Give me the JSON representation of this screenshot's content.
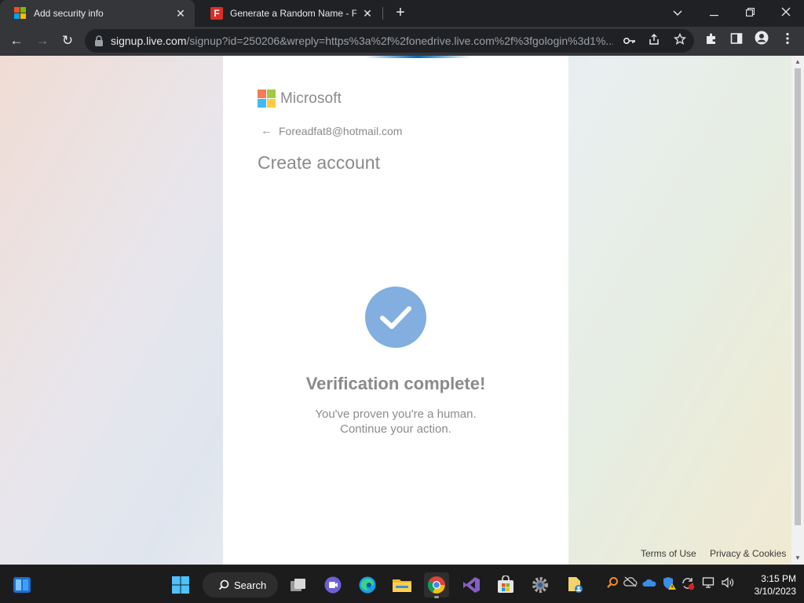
{
  "browser": {
    "tabs": [
      {
        "title": "Add security info",
        "active": true,
        "favicon": "microsoft-logo-icon"
      },
      {
        "title": "Generate a Random Name - Fake",
        "active": false,
        "favicon": "fake-name-generator-icon",
        "favicon_letter": "F"
      }
    ],
    "new_tab_glyph": "+",
    "window_controls": {
      "dropdown": "⌄",
      "minimize": "—",
      "restore": "❐",
      "close": "✕"
    },
    "url_host": "signup.live.com",
    "url_rest": "/signup?id=250206&wreply=https%3a%2f%2fonedrive.live.com%2f%3fgologin%3d1%...",
    "nav": {
      "back": "←",
      "forward": "→",
      "reload": "↻"
    }
  },
  "page": {
    "brand": "Microsoft",
    "identity_email": "Foreadfat8@hotmail.com",
    "back_arrow": "←",
    "title": "Create account",
    "verification_title": "Verification complete!",
    "verification_line1": "You've proven you're a human.",
    "verification_line2": "Continue your action.",
    "footer": {
      "terms": "Terms of Use",
      "privacy": "Privacy & Cookies"
    }
  },
  "taskbar": {
    "search_label": "Search",
    "time": "3:15 PM",
    "date": "3/10/2023"
  },
  "colors": {
    "ms_red": "#f25022",
    "ms_green": "#7fba00",
    "ms_blue": "#00a4ef",
    "ms_yellow": "#ffb900",
    "check_circle": "#82aee0",
    "chrome_dark": "#202124",
    "chrome_toolbar": "#35363a"
  }
}
